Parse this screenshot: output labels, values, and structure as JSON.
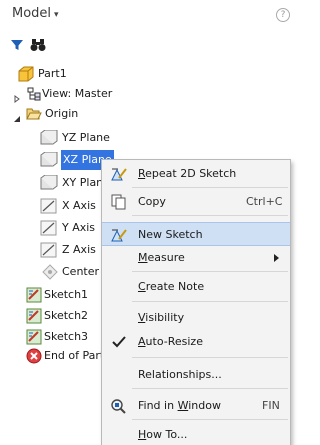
{
  "header": {
    "title": "Model",
    "caret": "▾",
    "help": "?"
  },
  "toolbar": {
    "filter_icon": "filter-icon",
    "find_icon": "binoculars-icon"
  },
  "tree": {
    "part": "Part1",
    "view": "View: Master",
    "origin": "Origin",
    "yz_plane": "YZ Plane",
    "xz_plane": "XZ Plane",
    "xy_plane": "XY Plane",
    "x_axis": "X Axis",
    "y_axis": "Y Axis",
    "z_axis": "Z Axis",
    "center_point": "Center Point",
    "sketch1": "Sketch1",
    "sketch2": "Sketch2",
    "sketch3": "Sketch3",
    "end_of_part": "End of Part"
  },
  "context_menu": {
    "repeat_2d_sketch": "Repeat 2D Sketch",
    "copy": "Copy",
    "copy_shortcut": "Ctrl+C",
    "new_sketch": "New Sketch",
    "measure": "Measure",
    "create_note": "Create Note",
    "visibility": "Visibility",
    "auto_resize": "Auto-Resize",
    "relationships": "Relationships...",
    "find_in_window": "Find in Window",
    "find_shortcut": "FIN",
    "how_to": "How To..."
  },
  "colors": {
    "selection": "#3374e0",
    "menu_highlight": "#cfe0f5",
    "menu_bg": "#f3f3f3"
  }
}
